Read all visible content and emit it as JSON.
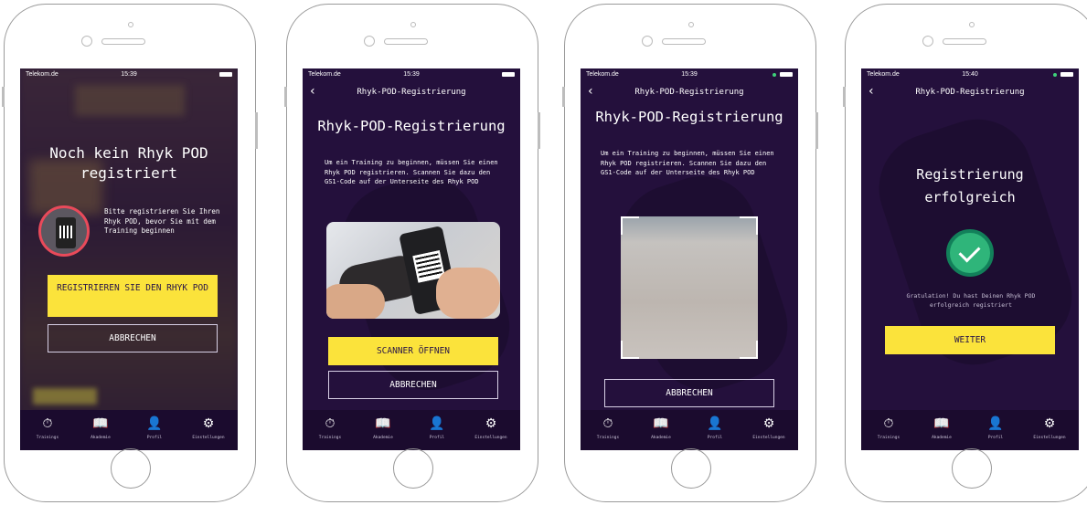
{
  "status": {
    "carrier": "Telekom.de",
    "times": [
      "15:39",
      "15:39",
      "15:39",
      "15:40"
    ]
  },
  "tabs": [
    {
      "label": "Trainings",
      "icon": "stopwatch-icon"
    },
    {
      "label": "Akademie",
      "icon": "academy-icon"
    },
    {
      "label": "Profil",
      "icon": "profile-icon"
    },
    {
      "label": "Einstellungen",
      "icon": "gear-icon"
    }
  ],
  "screen1": {
    "title": "Noch kein Rhyk POD registriert",
    "message": "Bitte registrieren Sie Ihren Rhyk POD, bevor Sie mit dem Training beginnen",
    "register_button": "REGISTRIEREN SIE DEN RHYK POD",
    "cancel_button": "ABBRECHEN"
  },
  "screen2": {
    "nav_title": "Rhyk-POD-Registrierung",
    "heading": "Rhyk-POD-Registrierung",
    "instructions": "Um ein Training zu beginnen, müssen Sie einen Rhyk POD registrieren. Scannen Sie dazu den GS1-Code auf der Unterseite des Rhyk POD",
    "scanner_button": "SCANNER ÖFFNEN",
    "cancel_button": "ABBRECHEN"
  },
  "screen3": {
    "nav_title": "Rhyk-POD-Registrierung",
    "heading": "Rhyk-POD-Registrierung",
    "instructions": "Um ein Training zu beginnen, müssen Sie einen Rhyk POD registrieren. Scannen Sie dazu den GS1-Code auf der Unterseite des Rhyk POD",
    "cancel_button": "ABBRECHEN"
  },
  "screen4": {
    "nav_title": "Rhyk-POD-Registrierung",
    "heading": "Registrierung erfolgreich",
    "message": "Gratulation! Du hast Deinen Rhyk POD erfolgreich registriert",
    "next_button": "WEITER"
  },
  "colors": {
    "background": "#24103c",
    "accent_yellow": "#fbe33b",
    "success_green": "#2fb57a"
  }
}
